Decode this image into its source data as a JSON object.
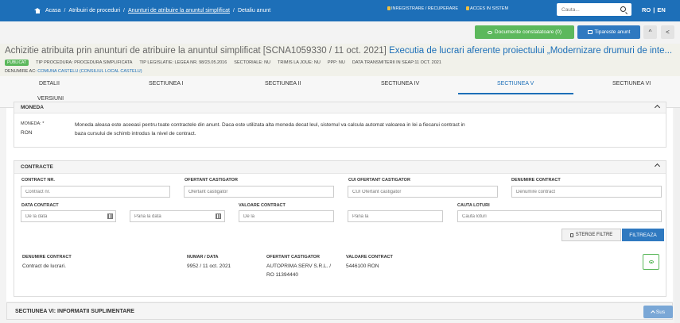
{
  "nav": {
    "home": "Acasa",
    "crumb1": "Atribuiri de proceduri",
    "crumb2": "Anunturi de atribuire la anuntul simplificat",
    "crumb3": "Detaliu anunt",
    "sep": "/",
    "register": "INREGISTRARE / RECUPERARE",
    "access": "ACCES IN SISTEM",
    "search_placeholder": "Cauta...",
    "lang_ro": "RO",
    "lang_sep": "|",
    "lang_en": "EN"
  },
  "actions": {
    "docs": "Documente constatatoare (0)",
    "print": "Tipareste anunt",
    "collapse": "^",
    "back": "<"
  },
  "header": {
    "title_code": "Achizitie atribuita prin anunturi de atribuire la anuntul simplificat [SCNA1059330 / 11 oct. 2021]",
    "title_link": "Executia de lucrari aferente proiectului „Modernizare drumuri de inte...",
    "badge": "PUBLICAT",
    "tip_procedura": "TIP PROCEDURA: PROCEDURA SIMPLIFICATA",
    "tip_legislatie": "TIP LEGISLATIE: LEGEA NR. 98/23.05.2016",
    "sectoriale": "SECTORIALE: NU",
    "trimis_joue": "TRIMIS LA JOUE: NU",
    "ppp": "PPP: NU",
    "data_transmiterii": "DATA TRANSMITERII IN SEAP:11 OCT. 2021",
    "denumire_label": "DENUMIRE AC:",
    "denumire_value": "COMUNA CASTELU (CONSILIUL LOCAL CASTELU)"
  },
  "tabs": {
    "detalii": "DETALII",
    "s1": "SECTIUNEA I",
    "s2": "SECTIUNEA II",
    "s4": "SECTIUNEA IV",
    "s5": "SECTIUNEA V",
    "s6": "SECTIUNEA VI",
    "versiuni": "VERSIUNI"
  },
  "moneda": {
    "heading": "MONEDA",
    "label": "MONEDA: *",
    "value": "RON",
    "text1": "Moneda aleasa este aceeasi pentru toate contractele din anunt. Daca este utilizata alta moneda decat leul, sistemul va calcula automat valoarea in lei a fiecarui contract in",
    "text2": "baza cursului de schimb introdus la nivel de contract."
  },
  "contracte": {
    "heading": "CONTRACTE",
    "f_contract_nr": {
      "label": "CONTRACT NR.",
      "placeholder": "Contract nr."
    },
    "f_ofertant": {
      "label": "OFERTANT CASTIGATOR",
      "placeholder": "Ofertant castigator"
    },
    "f_cui": {
      "label": "CUI OFERTANT CASTIGATOR",
      "placeholder": "CUI Ofertant castigator"
    },
    "f_denumire": {
      "label": "DENUMIRE CONTRACT",
      "placeholder": "Denumire contract"
    },
    "f_data": {
      "label": "DATA CONTRACT",
      "from": "De la data",
      "to": "Pana la data"
    },
    "f_valoare": {
      "label": "VALOARE CONTRACT",
      "from": "De la",
      "to": "Pana la"
    },
    "f_loturi": {
      "label": "CAUTA LOTURI",
      "placeholder": "Cauta loturi"
    },
    "clear": "STERGE FILTRE",
    "filter": "FILTREAZA",
    "row": {
      "h_denumire": "DENUMIRE CONTRACT",
      "denumire": "Contract de lucrari.",
      "h_numar": "NUMAR / DATA",
      "numar": "9952 / 11 oct. 2021",
      "h_ofertant": "OFERTANT CASTIGATOR",
      "ofertant1": "AUTOPRIMA SERV S.R.L. /",
      "ofertant2": "RO 11394440",
      "h_valoare": "VALOARE CONTRACT",
      "valoare": "5446100 RON"
    }
  },
  "sectiunea6": {
    "heading": "SECTIUNEA VI: INFORMATII SUPLIMENTARE",
    "scroll_top": "Sus"
  }
}
